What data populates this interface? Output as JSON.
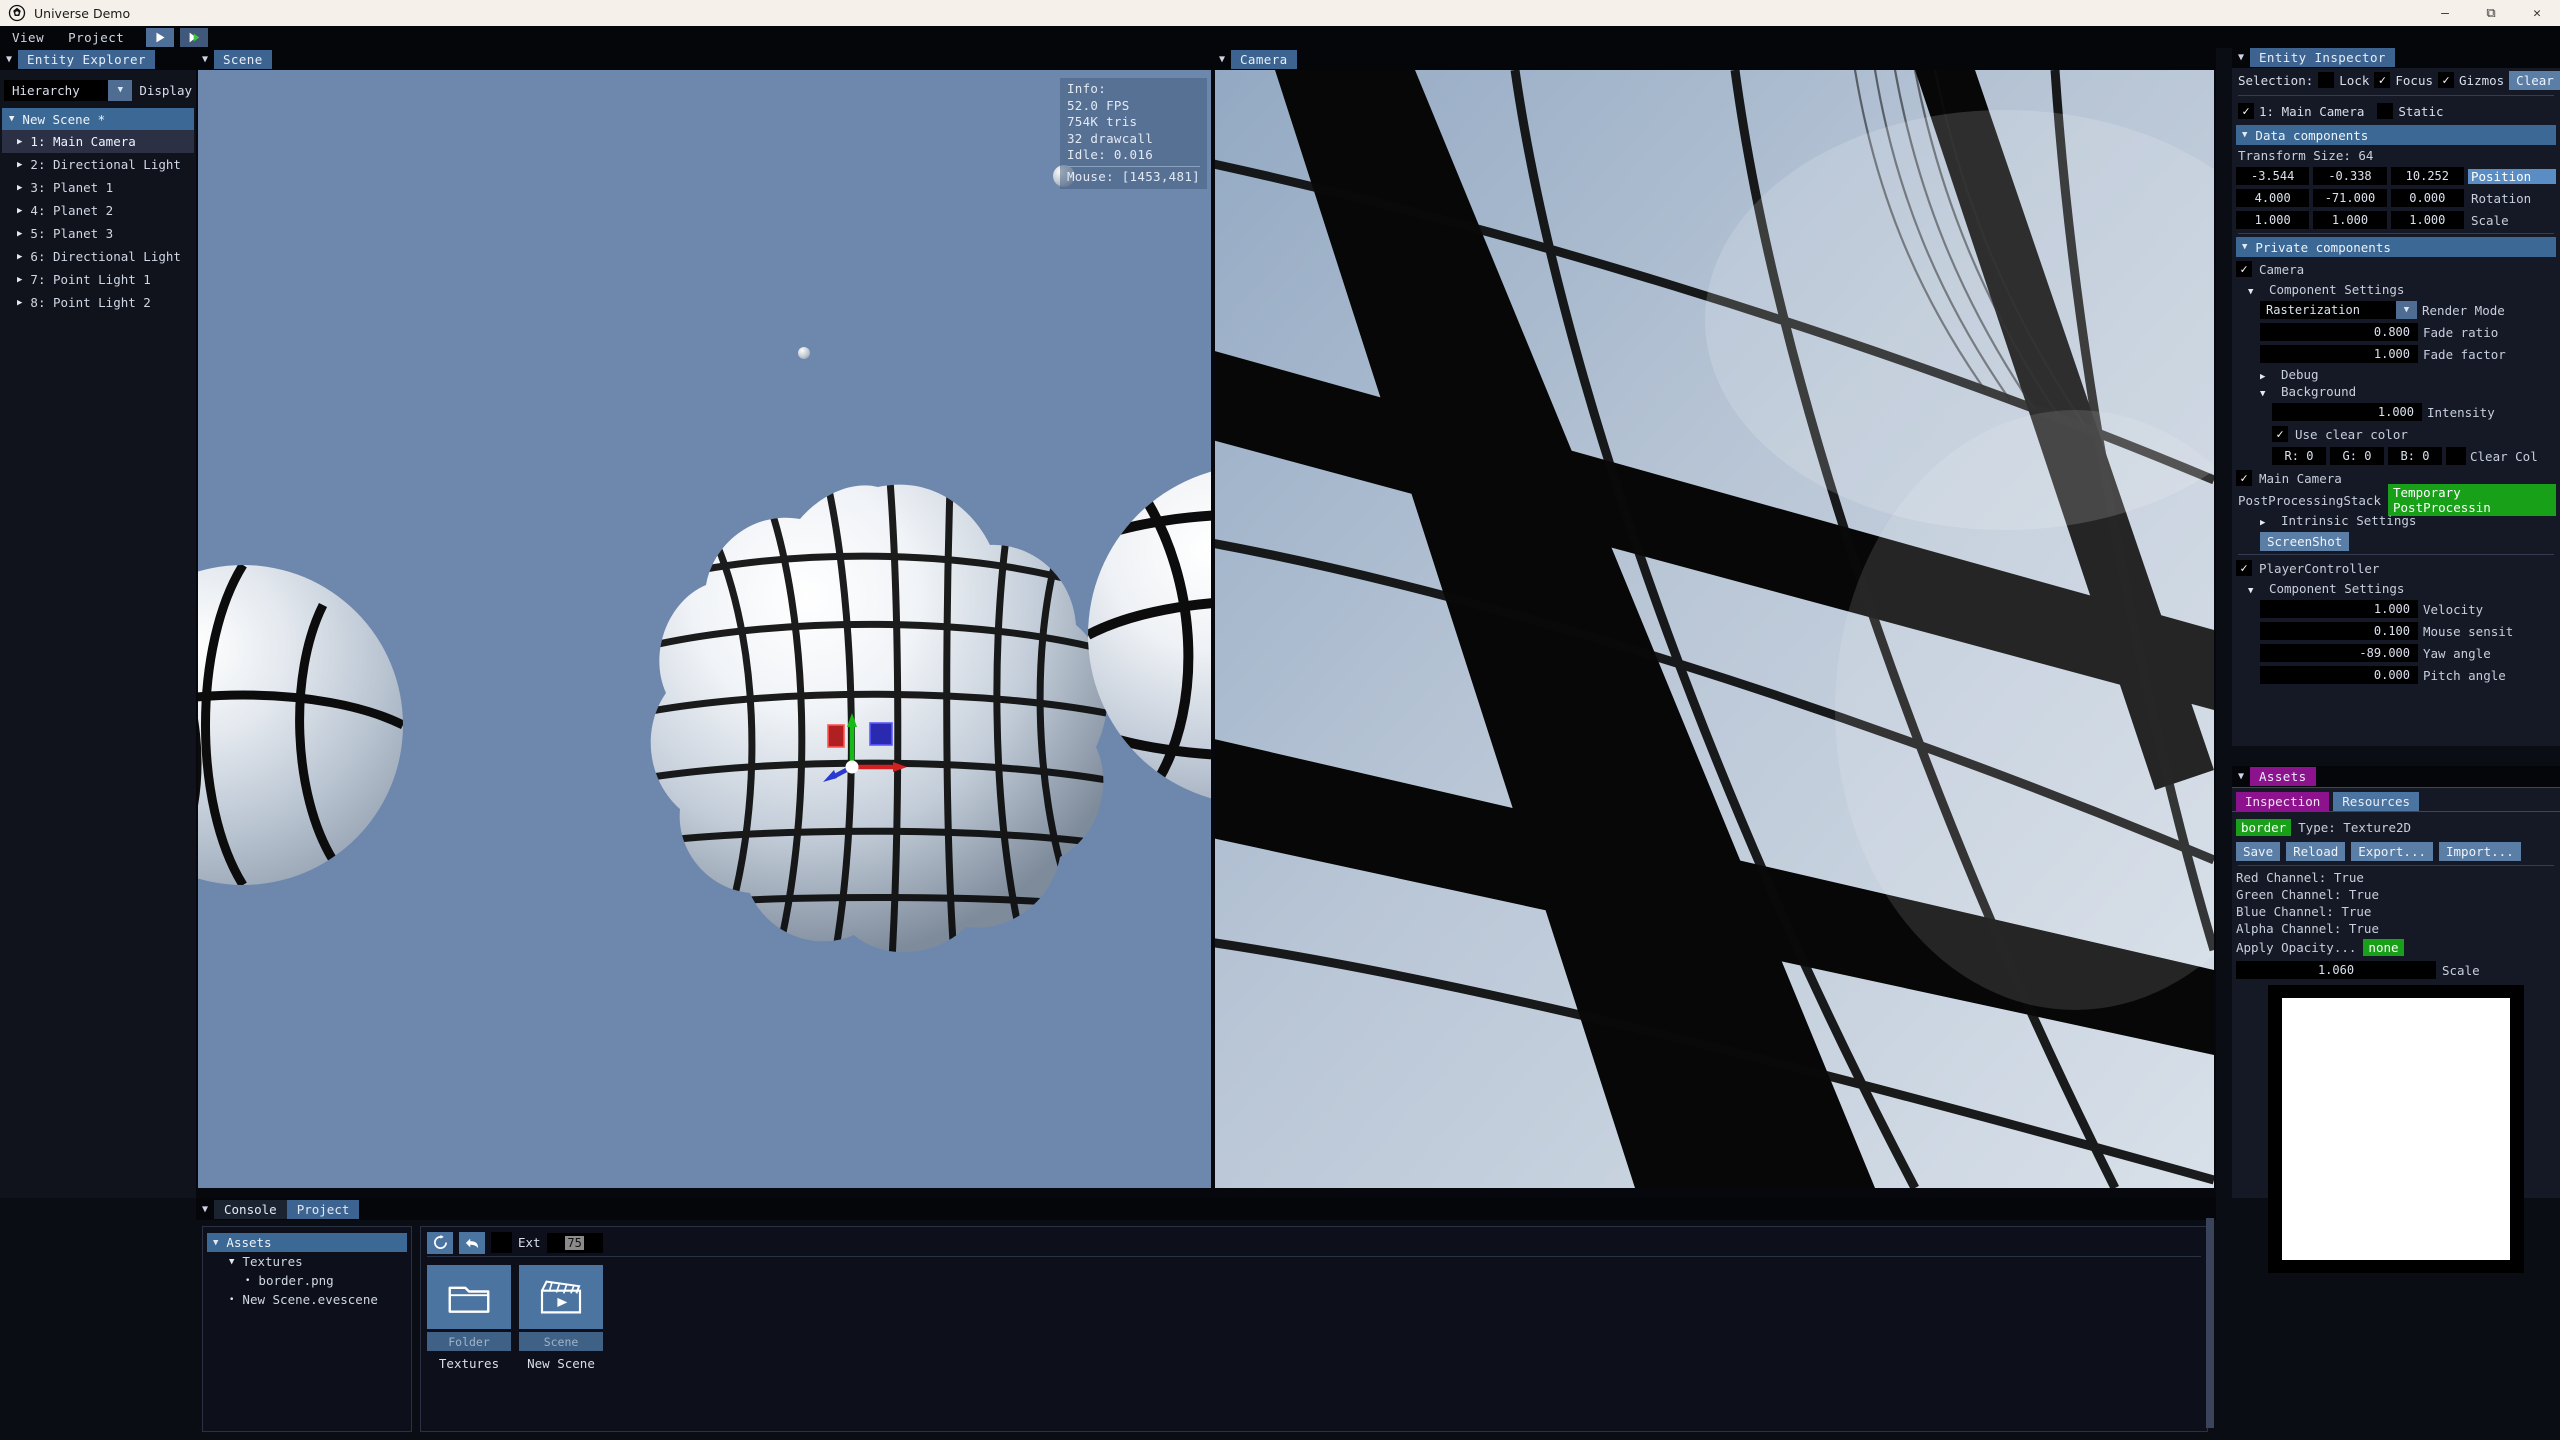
{
  "window": {
    "title": "Universe Demo",
    "logo_icon": "engine-logo-icon",
    "minimize_icon": "minimize-icon",
    "maximize_icon": "maximize-icon",
    "close_icon": "close-icon"
  },
  "menubar": {
    "items": [
      "View",
      "Project"
    ],
    "play_icon": "play-icon",
    "play_fast_icon": "play-fast-forward-icon"
  },
  "entity_explorer": {
    "panel_title": "Entity Explorer",
    "pin_icon": "panel-pin-icon",
    "display_mode": "Hierarchy",
    "display_label": "Display",
    "dropdown_icon": "chevron-down-icon",
    "scene_root": "New Scene *",
    "entities": [
      "1: Main Camera",
      "2: Directional Light",
      "3: Planet 1",
      "4: Planet 2",
      "5: Planet 3",
      "6: Directional Light",
      "7: Point Light 1",
      "8: Point Light 2"
    ],
    "selected_index": 0
  },
  "scene_viewport": {
    "tab": "Scene",
    "pin_icon": "panel-pin-icon",
    "info": {
      "header": "Info:",
      "fps": "52.0 FPS",
      "tris": "754K tris",
      "drawcalls": "32 drawcall",
      "idle": "Idle: 0.016",
      "mouse": "Mouse: [1453,481]"
    },
    "gizmo_icon": "transform-gizmo-icon"
  },
  "camera_viewport": {
    "tab": "Camera",
    "pin_icon": "panel-pin-icon"
  },
  "bottom_panel": {
    "pin_icon": "panel-pin-icon",
    "tabs": [
      {
        "label": "Console",
        "active": false
      },
      {
        "label": "Project",
        "active": true
      }
    ],
    "tree": [
      {
        "label": "Assets",
        "depth": 0,
        "marker": "▼",
        "selected": true
      },
      {
        "label": "Textures",
        "depth": 1,
        "marker": "▼",
        "selected": false
      },
      {
        "label": "border.png",
        "depth": 2,
        "marker": "•",
        "selected": false
      },
      {
        "label": "New Scene.evescene",
        "depth": 1,
        "marker": "•",
        "selected": false
      }
    ],
    "toolbar": {
      "refresh_icon": "refresh-icon",
      "back_icon": "back-arrow-icon",
      "color_swatch": "#000000",
      "ext_label": "Ext",
      "ext_value": "75"
    },
    "assets": [
      {
        "name": "Textures",
        "kind": "Folder",
        "icon": "folder-icon"
      },
      {
        "name": "New Scene",
        "kind": "Scene",
        "icon": "clapperboard-play-icon"
      }
    ]
  },
  "inspector": {
    "panel_title": "Entity Inspector",
    "pin_icon": "panel-pin-icon",
    "selection_label": "Selection:",
    "lock": {
      "label": "Lock",
      "checked": false
    },
    "focus": {
      "label": "Focus",
      "checked": true
    },
    "gizmos": {
      "label": "Gizmos",
      "checked": true
    },
    "clear_button": "Clear",
    "entity": {
      "name": "1: Main Camera",
      "enabled": true
    },
    "static": {
      "label": "Static",
      "checked": false
    },
    "data_components_header": "Data components",
    "transform_size": "Transform Size: 64",
    "transform": [
      {
        "label": "Position",
        "highlight": true,
        "values": [
          "-3.544",
          "-0.338",
          "10.252"
        ]
      },
      {
        "label": "Rotation",
        "highlight": false,
        "values": [
          "4.000",
          "-71.000",
          "0.000"
        ]
      },
      {
        "label": "Scale",
        "highlight": false,
        "values": [
          "1.000",
          "1.000",
          "1.000"
        ]
      }
    ],
    "private_components_header": "Private components",
    "camera": {
      "name": "Camera",
      "enabled": true,
      "settings_label": "Component Settings",
      "render_mode": {
        "label": "Render Mode",
        "value": "Rasterization"
      },
      "fade_ratio": {
        "label": "Fade ratio",
        "value": "0.800"
      },
      "fade_factor": {
        "label": "Fade factor",
        "value": "1.000"
      },
      "debug_label": "Debug",
      "background_label": "Background",
      "intensity": {
        "label": "Intensity",
        "value": "1.000"
      },
      "use_clear_color": {
        "label": "Use clear color",
        "checked": true
      },
      "clear_color": {
        "label": "Clear Col",
        "r": "R:  0",
        "g": "G:  0",
        "b": "B:  0",
        "swatch": "#000000"
      },
      "main_camera": {
        "label": "Main Camera",
        "checked": true
      },
      "postprocessing_label": "PostProcessingStack",
      "postprocessing_value": "Temporary PostProcessin",
      "intrinsic_settings": "Intrinsic Settings",
      "screenshot_button": "ScreenShot"
    },
    "player_controller": {
      "name": "PlayerController",
      "enabled": true,
      "settings_label": "Component Settings",
      "velocity": {
        "label": "Velocity",
        "value": "1.000"
      },
      "mouse_sensitivity": {
        "label": "Mouse sensit",
        "value": "0.100"
      },
      "yaw_angle": {
        "label": "Yaw angle",
        "value": "-89.000"
      },
      "pitch_angle": {
        "label": "Pitch angle",
        "value": "0.000"
      }
    }
  },
  "assets_panel": {
    "panel_title": "Assets",
    "pin_icon": "panel-pin-icon",
    "tabs": [
      {
        "label": "Inspection",
        "active": true
      },
      {
        "label": "Resources",
        "active": false
      }
    ],
    "asset_name": "border",
    "type_label": "Type: Texture2D",
    "buttons": [
      "Save",
      "Reload",
      "Export...",
      "Import..."
    ],
    "channels": [
      "Red Channel: True",
      "Green Channel: True",
      "Blue Channel: True",
      "Alpha Channel: True"
    ],
    "apply_opacity_label": "Apply Opacity...",
    "apply_opacity_value": "none",
    "scale": {
      "label": "Scale",
      "value": "1.060"
    }
  },
  "colors": {
    "accent_blue": "#3b6894",
    "accent_magenta": "#8d128d",
    "accent_green": "#18a018",
    "panel_bg": "#151825",
    "scene_bg": "#6d87ad",
    "camera_bg": "#8ba2bf"
  }
}
